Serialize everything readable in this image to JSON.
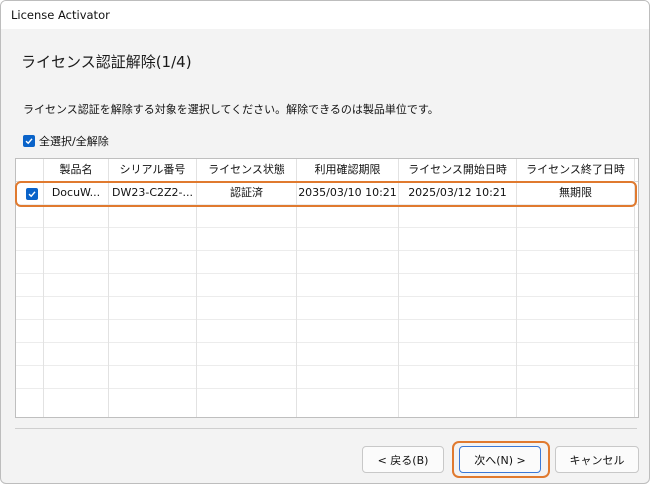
{
  "window": {
    "title": "License Activator"
  },
  "page": {
    "heading": "ライセンス認証解除(1/4)",
    "instruction": "ライセンス認証を解除する対象を選択してください。解除できるのは製品単位です。",
    "select_all_label": "全選択/全解除",
    "select_all_checked": true
  },
  "table": {
    "columns": [
      "製品名",
      "シリアル番号",
      "ライセンス状態",
      "利用確認期限",
      "ライセンス開始日時",
      "ライセンス終了日時"
    ],
    "rows": [
      {
        "checked": true,
        "product": "DocuW...",
        "serial": "DW23-C2Z2-...",
        "status": "認証済",
        "confirm_deadline": "2035/03/10 10:21",
        "start": "2025/03/12 10:21",
        "end": "無期限"
      }
    ]
  },
  "buttons": {
    "back": "< 戻る(B)",
    "next": "次へ(N) >",
    "cancel": "キャンセル"
  },
  "colors": {
    "accent": "#0a63c9",
    "highlight": "#e07a2f"
  }
}
